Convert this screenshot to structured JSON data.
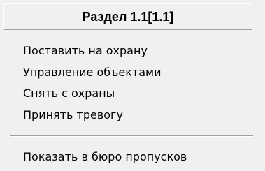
{
  "menu": {
    "header": "Раздел 1.1[1.1]",
    "items": [
      {
        "label": "Поставить на охрану"
      },
      {
        "label": "Управление объектами"
      },
      {
        "label": "Снять с охраны"
      },
      {
        "label": "Принять тревогу"
      },
      {
        "label": "Показать в бюро пропусков"
      }
    ]
  },
  "colors": {
    "menu_background": "#f0f0f0",
    "separator_dark": "#a0a0a0",
    "separator_light": "#ffffff",
    "text": "#000000"
  }
}
